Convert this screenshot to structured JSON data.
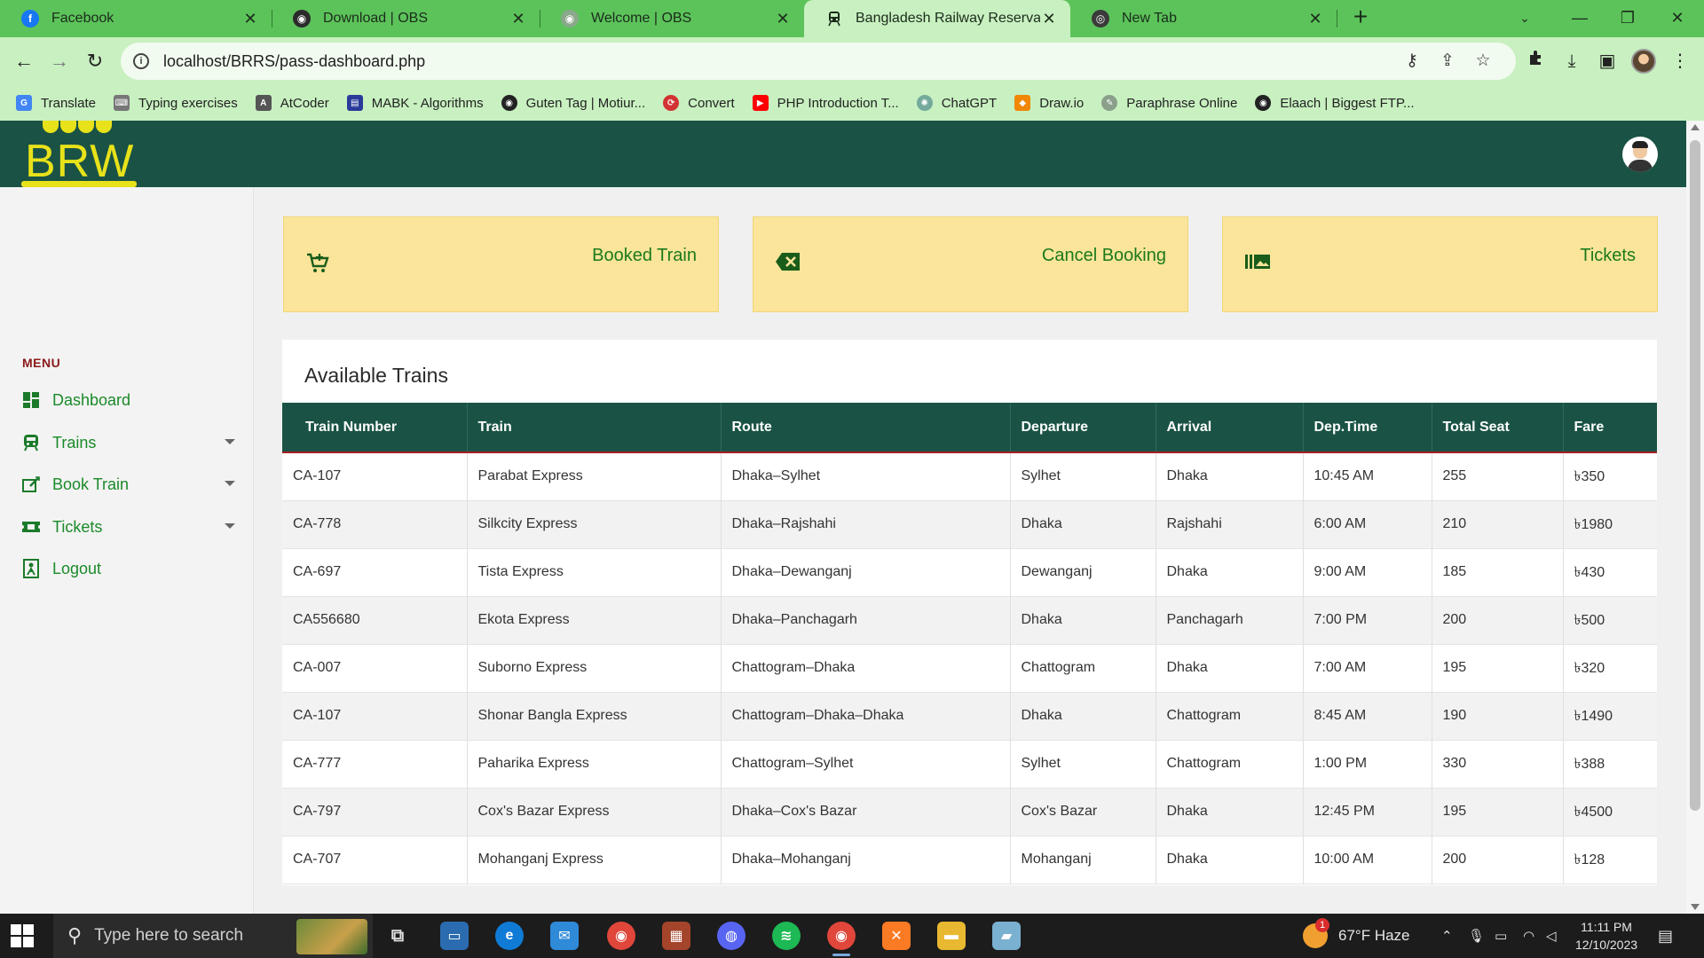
{
  "browser": {
    "tabs": [
      {
        "title": "Facebook",
        "icon": "facebook-icon",
        "color": "#1877f2",
        "glyph": "f"
      },
      {
        "title": "Download | OBS",
        "icon": "obs-icon",
        "color": "#2b2b2b",
        "glyph": "◉"
      },
      {
        "title": "Welcome | OBS",
        "icon": "obs-icon",
        "color": "#8aa88a",
        "glyph": "◉"
      },
      {
        "title": "Bangladesh Railway Reservation",
        "icon": "train-icon",
        "color": "#1b2b1b",
        "glyph": "🚆"
      },
      {
        "title": "New Tab",
        "icon": "chrome-icon",
        "color": "#3a3a3a",
        "glyph": "◎"
      }
    ],
    "new_tab_label": "+",
    "url": "localhost/BRRS/pass-dashboard.php",
    "bookmarks": [
      {
        "label": "Translate",
        "icon": "translate-icon",
        "color": "#4285f4"
      },
      {
        "label": "Typing exercises",
        "icon": "keyboard-icon",
        "color": "#777777"
      },
      {
        "label": "AtCoder",
        "icon": "atcoder-icon",
        "color": "#555555"
      },
      {
        "label": "MABK - Algorithms",
        "icon": "mabk-icon",
        "color": "#2a3a9a"
      },
      {
        "label": "Guten Tag | Motiur...",
        "icon": "globe-icon",
        "color": "#222222"
      },
      {
        "label": "Convert",
        "icon": "convert-icon",
        "color": "#d33333"
      },
      {
        "label": "PHP Introduction T...",
        "icon": "youtube-icon",
        "color": "#ff0000"
      },
      {
        "label": "ChatGPT",
        "icon": "chatgpt-icon",
        "color": "#74aa9c"
      },
      {
        "label": "Draw.io",
        "icon": "drawio-icon",
        "color": "#f08705"
      },
      {
        "label": "Paraphrase Online",
        "icon": "paraphrase-icon",
        "color": "#8aa08a"
      },
      {
        "label": "Elaach | Biggest FTP...",
        "icon": "globe-icon",
        "color": "#222222"
      }
    ]
  },
  "site": {
    "logo_text": "BRW",
    "menu_title": "MENU",
    "menu": [
      {
        "label": "Dashboard",
        "icon": "dashboard-icon",
        "dropdown": false
      },
      {
        "label": "Trains",
        "icon": "train-icon",
        "dropdown": true
      },
      {
        "label": "Book Train",
        "icon": "book-icon",
        "dropdown": true
      },
      {
        "label": "Tickets",
        "icon": "ticket-icon",
        "dropdown": true
      },
      {
        "label": "Logout",
        "icon": "logout-icon",
        "dropdown": false
      }
    ],
    "cards": [
      {
        "label": "Booked Train",
        "icon": "cart-icon"
      },
      {
        "label": "Cancel Booking",
        "icon": "cancel-icon"
      },
      {
        "label": "Tickets",
        "icon": "tickets-icon"
      }
    ],
    "table": {
      "title": "Available Trains",
      "columns": [
        "Train Number",
        "Train",
        "Route",
        "Departure",
        "Arrival",
        "Dep.Time",
        "Total Seat",
        "Fare"
      ],
      "rows": [
        [
          "CA-107",
          "Parabat Express",
          "Dhaka–Sylhet",
          "Sylhet",
          "Dhaka",
          "10:45 AM",
          "255",
          "৳350"
        ],
        [
          "CA-778",
          "Silkcity Express",
          "Dhaka–Rajshahi",
          "Dhaka",
          "Rajshahi",
          "6:00 AM",
          "210",
          "৳1980"
        ],
        [
          "CA-697",
          "Tista Express",
          "Dhaka–Dewanganj",
          "Dewanganj",
          "Dhaka",
          "9:00 AM",
          "185",
          "৳430"
        ],
        [
          "CA556680",
          "Ekota Express",
          "Dhaka–Panchagarh",
          "Dhaka",
          "Panchagarh",
          "7:00 PM",
          "200",
          "৳500"
        ],
        [
          "CA-007",
          "Suborno Express",
          "Chattogram–Dhaka",
          "Chattogram",
          "Dhaka",
          "7:00 AM",
          "195",
          "৳320"
        ],
        [
          "CA-107",
          "Shonar Bangla Express",
          "Chattogram–Dhaka–Dhaka",
          "Dhaka",
          "Chattogram",
          "8:45 AM",
          "190",
          "৳1490"
        ],
        [
          "CA-777",
          "Paharika Express",
          "Chattogram–Sylhet",
          "Sylhet",
          "Chattogram",
          "1:00 PM",
          "330",
          "৳388"
        ],
        [
          "CA-797",
          "Cox's Bazar Express",
          "Dhaka–Cox's Bazar",
          "Cox's Bazar",
          "Dhaka",
          "12:45 PM",
          "195",
          "৳4500"
        ],
        [
          "CA-707",
          "Mohanganj Express",
          "Dhaka–Mohanganj",
          "Mohanganj",
          "Dhaka",
          "10:00 AM",
          "200",
          "৳128"
        ]
      ]
    }
  },
  "taskbar": {
    "search_placeholder": "Type here to search",
    "weather": "67°F  Haze",
    "weather_badge": "1",
    "time": "11:11 PM",
    "date": "12/10/2023"
  },
  "colors": {
    "tab_bar": "#5cc35a",
    "toolbar": "#c8f0c0",
    "header": "#1a5345",
    "logo": "#e8e21a",
    "card_bg": "#fbe59a",
    "menu_text": "#1b8a2a"
  }
}
